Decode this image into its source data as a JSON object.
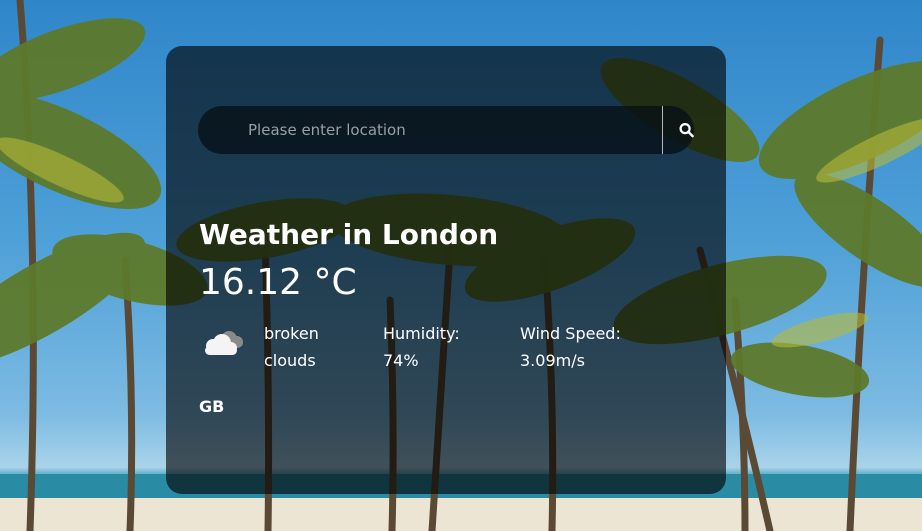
{
  "search": {
    "placeholder": "Please enter location",
    "value": "",
    "button_icon": "search-icon"
  },
  "weather": {
    "title": "Weather in London",
    "temperature": "16.12 °C",
    "icon": "broken-clouds-icon",
    "description": "broken clouds",
    "humidity_label": "Humidity:",
    "humidity_value": "74%",
    "wind_label": "Wind Speed:",
    "wind_value": "3.09m/s",
    "country": "GB"
  },
  "colors": {
    "card_background": "#000000",
    "text": "#ffffff",
    "placeholder": "#9a9fa3",
    "sky": "#2f86c9"
  }
}
